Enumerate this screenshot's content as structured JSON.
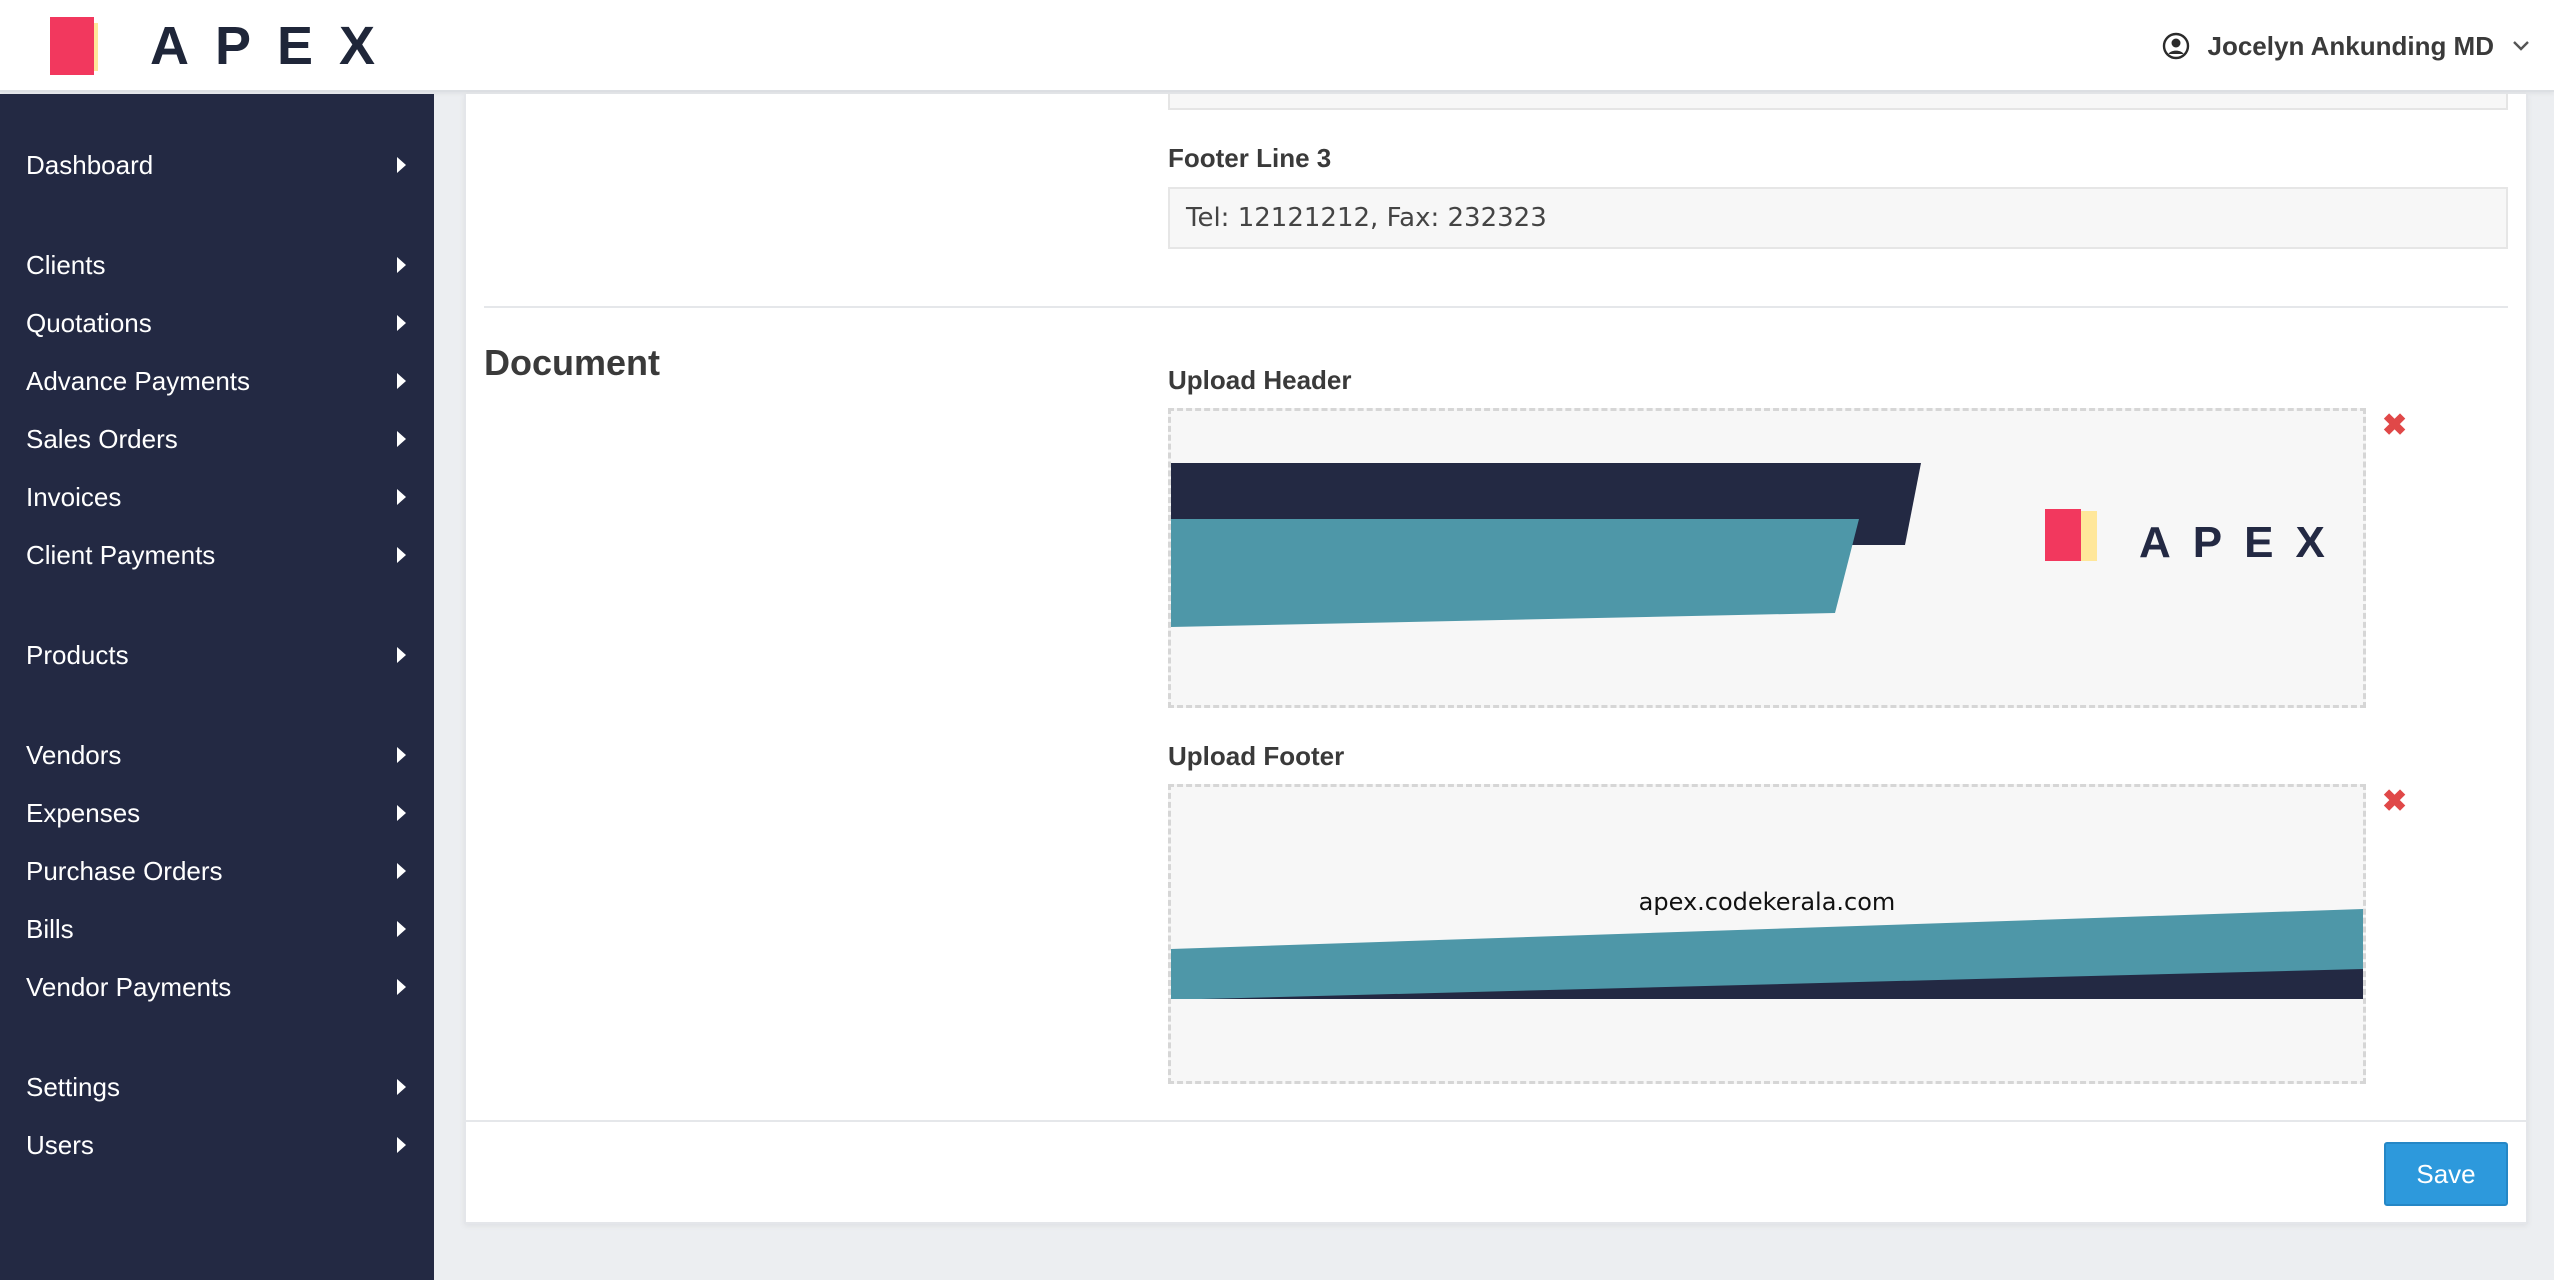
{
  "app": {
    "brand": "APEX",
    "user_name": "Jocelyn Ankunding MD"
  },
  "sidebar": {
    "items": [
      {
        "label": "Dashboard"
      },
      {
        "label": "Clients"
      },
      {
        "label": "Quotations"
      },
      {
        "label": "Advance Payments"
      },
      {
        "label": "Sales Orders"
      },
      {
        "label": "Invoices"
      },
      {
        "label": "Client Payments"
      },
      {
        "label": "Products"
      },
      {
        "label": "Vendors"
      },
      {
        "label": "Expenses"
      },
      {
        "label": "Purchase Orders"
      },
      {
        "label": "Bills"
      },
      {
        "label": "Vendor Payments"
      },
      {
        "label": "Settings"
      },
      {
        "label": "Users"
      }
    ]
  },
  "form": {
    "footer_line3": {
      "label": "Footer Line 3",
      "value": "Tel: 12121212, Fax: 232323"
    },
    "document": {
      "title": "Document",
      "upload_header": {
        "label": "Upload Header",
        "image_brand": "APEX",
        "remove": "✖"
      },
      "upload_footer": {
        "label": "Upload Footer",
        "image_url_text": "apex.codekerala.com",
        "remove": "✖"
      }
    },
    "save_label": "Save"
  },
  "colors": {
    "sidebar_bg": "#232943",
    "brand_pink": "#f2385e",
    "brand_yellow": "#ffe79a",
    "navy": "#232943",
    "teal": "#4e97a8",
    "primary": "#2d99dc",
    "danger": "#e04848"
  }
}
